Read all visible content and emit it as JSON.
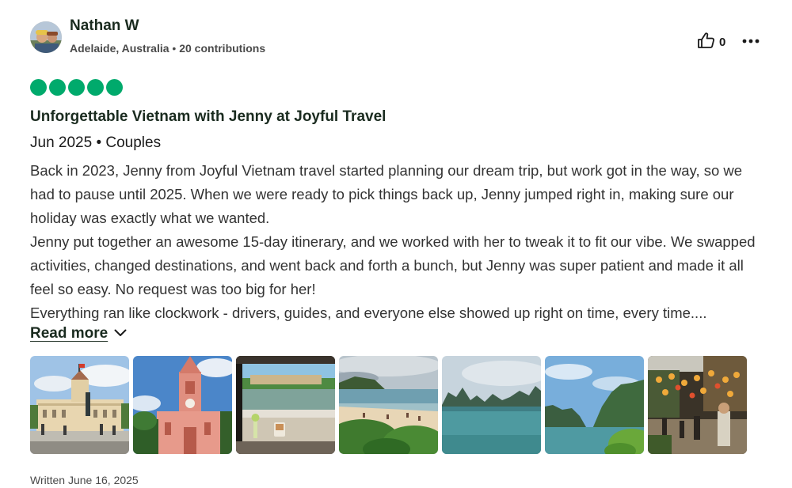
{
  "author": {
    "name": "Nathan W",
    "location": "Adelaide, Australia",
    "separator": " • ",
    "contributions": "20 contributions"
  },
  "helpful": {
    "count": "0",
    "icon": "thumbs-up-icon"
  },
  "more": {
    "icon": "more-horizontal-icon"
  },
  "rating": {
    "value": 5,
    "max": 5,
    "color": "#00aa6c"
  },
  "review": {
    "title": "Unforgettable Vietnam with Jenny at Joyful Travel",
    "trip": "Jun 2025 • Couples",
    "paragraphs": [
      "Back in 2023, Jenny from Joyful Vietnam travel started planning our dream trip, but work got in the way, so we had to pause until 2025. When we were ready to pick things back up, Jenny jumped right in, making sure our holiday was exactly what we wanted.",
      "Jenny put together an awesome 15-day itinerary, and we worked with her to tweak it to fit our vibe. We swapped activities, changed destinations, and went back and forth a bunch, but Jenny was super patient and made it all feel so easy. No request was too big for her!",
      "Everything ran like clockwork - drivers, guides, and everyone else showed up right on time, every time...."
    ],
    "read_more": "Read more",
    "written": "Written June 16, 2025"
  },
  "photos": [
    {
      "name": "photo-city-hall"
    },
    {
      "name": "photo-pink-church"
    },
    {
      "name": "photo-cafe-view"
    },
    {
      "name": "photo-beach"
    },
    {
      "name": "photo-halong-bay"
    },
    {
      "name": "photo-karst-water"
    },
    {
      "name": "photo-lantern-street"
    }
  ]
}
